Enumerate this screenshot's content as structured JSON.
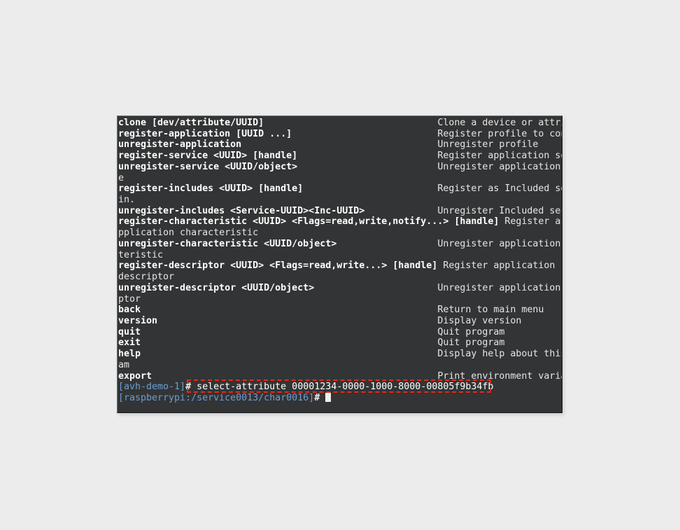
{
  "window": {
    "type": "terminal",
    "background_color": "#333435",
    "page_background_color": "#ececec",
    "text_color": "#e8e8e8"
  },
  "terminal": {
    "lines": [
      {
        "cmd": "clone [dev/attribute/UUID]                               ",
        "desc": "Clone a device or attribute"
      },
      {
        "cmd": "register-application [UUID ...]                          ",
        "desc": "Register profile to connect"
      },
      {
        "cmd": "unregister-application                                   ",
        "desc": "Unregister profile"
      },
      {
        "cmd": "register-service <UUID> [handle]                         ",
        "desc": "Register application service."
      },
      {
        "cmd": "unregister-service <UUID/object>                         ",
        "desc": "Unregister application servic"
      },
      {
        "cmd": "",
        "desc": "e"
      },
      {
        "cmd": "register-includes <UUID> [handle]                        ",
        "desc": "Register as Included service"
      },
      {
        "cmd": "",
        "desc": "in."
      },
      {
        "cmd": "unregister-includes <Service-UUID><Inc-UUID>             ",
        "desc": "Unregister Included service."
      },
      {
        "cmd": "register-characteristic <UUID> <Flags=read,write,notify...> [handle] ",
        "desc": "Register a"
      },
      {
        "cmd": "",
        "desc": "pplication characteristic"
      },
      {
        "cmd": "unregister-characteristic <UUID/object>                  ",
        "desc": "Unregister application charac"
      },
      {
        "cmd": "",
        "desc": "teristic"
      },
      {
        "cmd": "register-descriptor <UUID> <Flags=read,write...> [handle] ",
        "desc": "Register application"
      },
      {
        "cmd": "",
        "desc": "descriptor"
      },
      {
        "cmd": "unregister-descriptor <UUID/object>                      ",
        "desc": "Unregister application descri"
      },
      {
        "cmd": "",
        "desc": "ptor"
      },
      {
        "cmd": "back                                                     ",
        "desc": "Return to main menu"
      },
      {
        "cmd": "version                                                  ",
        "desc": "Display version"
      },
      {
        "cmd": "quit                                                     ",
        "desc": "Quit program"
      },
      {
        "cmd": "exit                                                     ",
        "desc": "Quit program"
      },
      {
        "cmd": "help                                                     ",
        "desc": "Display help about this progr"
      },
      {
        "cmd": "",
        "desc": "am"
      },
      {
        "cmd": "export                                                   ",
        "desc": "Print environment variables"
      }
    ],
    "prompt_1": {
      "host": "[avh-demo-1]",
      "hash": "# ",
      "typed_command": "select-attribute 00001234-0000-1000-8000-00805f9b34fb"
    },
    "prompt_2": {
      "host": "[raspberrypi:/service0013/char0016]",
      "hash": "# ",
      "typed_command": ""
    }
  },
  "annotation": {
    "highlight_color": "#e8271b",
    "highlight_label": "select-attribute-command-highlight"
  }
}
